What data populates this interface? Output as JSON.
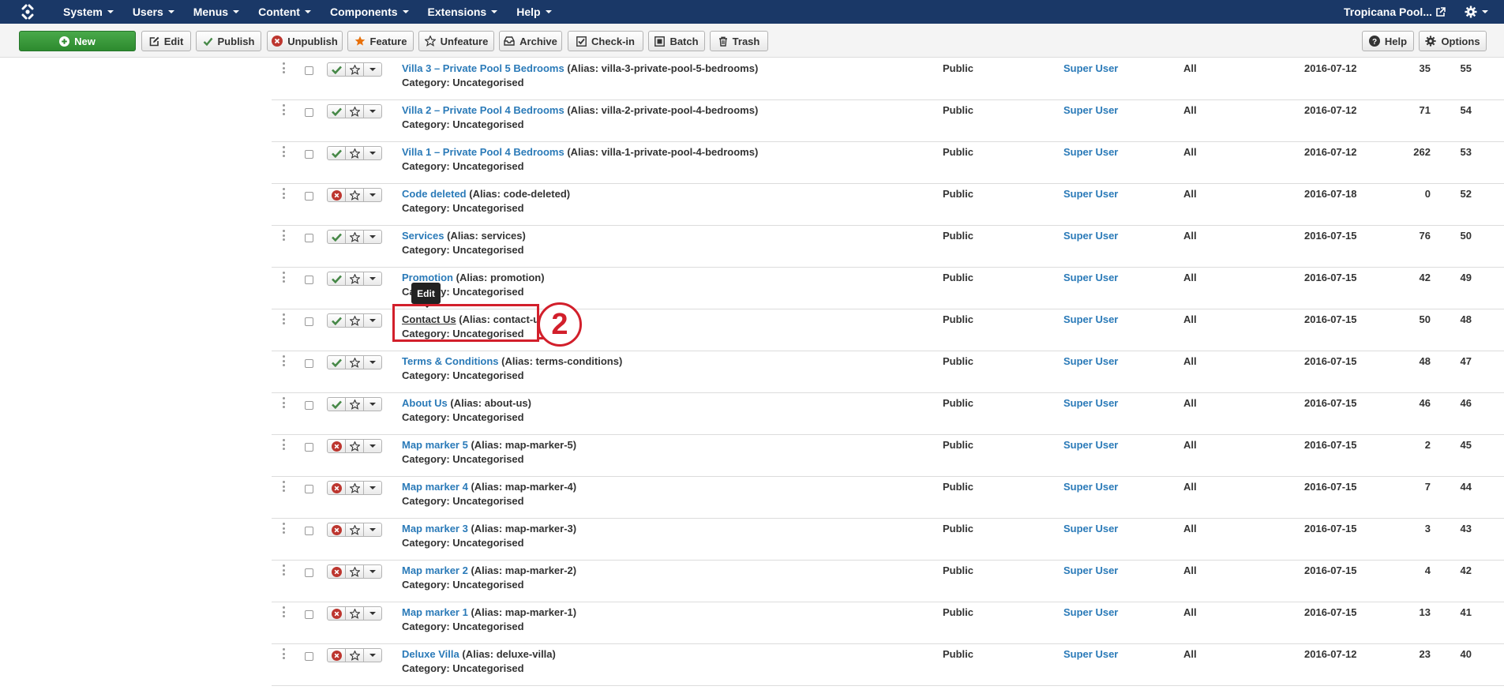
{
  "navbar": {
    "brand_icon": "joomla-logo-icon",
    "menus": [
      "System",
      "Users",
      "Menus",
      "Content",
      "Components",
      "Extensions",
      "Help"
    ],
    "site_name": "Tropicana Pool...",
    "site_icon": "external-link-icon",
    "settings_icon": "gear-icon"
  },
  "toolbar": {
    "new": "New",
    "edit": "Edit",
    "publish": "Publish",
    "unpublish": "Unpublish",
    "feature": "Feature",
    "unfeature": "Unfeature",
    "archive": "Archive",
    "checkin": "Check-in",
    "batch": "Batch",
    "trash": "Trash",
    "help": "Help",
    "options": "Options"
  },
  "colors": {
    "navbar": "#1a3867",
    "link": "#2a7ab8",
    "published": "#468847",
    "unpublished": "#bd362f",
    "annotation": "#d21f2b"
  },
  "tooltip": "Edit",
  "annotation_label": "2",
  "articles": [
    {
      "title": "Villa 3 – Private Pool 5 Bedrooms",
      "alias": "(Alias: villa-3-private-pool-5-bedrooms)",
      "category": "Category: Uncategorised",
      "published": true,
      "access": "Public",
      "author": "Super User",
      "language": "All",
      "date": "2016-07-12",
      "hits": "35",
      "id": "55"
    },
    {
      "title": "Villa 2 – Private Pool 4 Bedrooms",
      "alias": "(Alias: villa-2-private-pool-4-bedrooms)",
      "category": "Category: Uncategorised",
      "published": true,
      "access": "Public",
      "author": "Super User",
      "language": "All",
      "date": "2016-07-12",
      "hits": "71",
      "id": "54"
    },
    {
      "title": "Villa 1 – Private Pool 4 Bedrooms",
      "alias": "(Alias: villa-1-private-pool-4-bedrooms)",
      "category": "Category: Uncategorised",
      "published": true,
      "access": "Public",
      "author": "Super User",
      "language": "All",
      "date": "2016-07-12",
      "hits": "262",
      "id": "53"
    },
    {
      "title": "Code deleted",
      "alias": "(Alias: code-deleted)",
      "category": "Category: Uncategorised",
      "published": false,
      "access": "Public",
      "author": "Super User",
      "language": "All",
      "date": "2016-07-18",
      "hits": "0",
      "id": "52"
    },
    {
      "title": "Services",
      "alias": "(Alias: services)",
      "category": "Category: Uncategorised",
      "published": true,
      "access": "Public",
      "author": "Super User",
      "language": "All",
      "date": "2016-07-15",
      "hits": "76",
      "id": "50"
    },
    {
      "title": "Promotion",
      "alias": "(Alias: promotion)",
      "category": "Category: Uncategorised",
      "published": true,
      "access": "Public",
      "author": "Super User",
      "language": "All",
      "date": "2016-07-15",
      "hits": "42",
      "id": "49"
    },
    {
      "title": "Contact Us",
      "alias": "(Alias: contact-us)",
      "category": "Category: Uncategorised",
      "published": true,
      "access": "Public",
      "author": "Super User",
      "language": "All",
      "date": "2016-07-15",
      "hits": "50",
      "id": "48",
      "active": true
    },
    {
      "title": "Terms & Conditions",
      "alias": "(Alias: terms-conditions)",
      "category": "Category: Uncategorised",
      "published": true,
      "access": "Public",
      "author": "Super User",
      "language": "All",
      "date": "2016-07-15",
      "hits": "48",
      "id": "47"
    },
    {
      "title": "About Us",
      "alias": "(Alias: about-us)",
      "category": "Category: Uncategorised",
      "published": true,
      "access": "Public",
      "author": "Super User",
      "language": "All",
      "date": "2016-07-15",
      "hits": "46",
      "id": "46"
    },
    {
      "title": "Map marker 5",
      "alias": "(Alias: map-marker-5)",
      "category": "Category: Uncategorised",
      "published": false,
      "access": "Public",
      "author": "Super User",
      "language": "All",
      "date": "2016-07-15",
      "hits": "2",
      "id": "45"
    },
    {
      "title": "Map marker 4",
      "alias": "(Alias: map-marker-4)",
      "category": "Category: Uncategorised",
      "published": false,
      "access": "Public",
      "author": "Super User",
      "language": "All",
      "date": "2016-07-15",
      "hits": "7",
      "id": "44"
    },
    {
      "title": "Map marker 3",
      "alias": "(Alias: map-marker-3)",
      "category": "Category: Uncategorised",
      "published": false,
      "access": "Public",
      "author": "Super User",
      "language": "All",
      "date": "2016-07-15",
      "hits": "3",
      "id": "43"
    },
    {
      "title": "Map marker 2",
      "alias": "(Alias: map-marker-2)",
      "category": "Category: Uncategorised",
      "published": false,
      "access": "Public",
      "author": "Super User",
      "language": "All",
      "date": "2016-07-15",
      "hits": "4",
      "id": "42"
    },
    {
      "title": "Map marker 1",
      "alias": "(Alias: map-marker-1)",
      "category": "Category: Uncategorised",
      "published": false,
      "access": "Public",
      "author": "Super User",
      "language": "All",
      "date": "2016-07-15",
      "hits": "13",
      "id": "41"
    },
    {
      "title": "Deluxe Villa",
      "alias": "(Alias: deluxe-villa)",
      "category": "Category: Uncategorised",
      "published": false,
      "access": "Public",
      "author": "Super User",
      "language": "All",
      "date": "2016-07-12",
      "hits": "23",
      "id": "40"
    }
  ]
}
